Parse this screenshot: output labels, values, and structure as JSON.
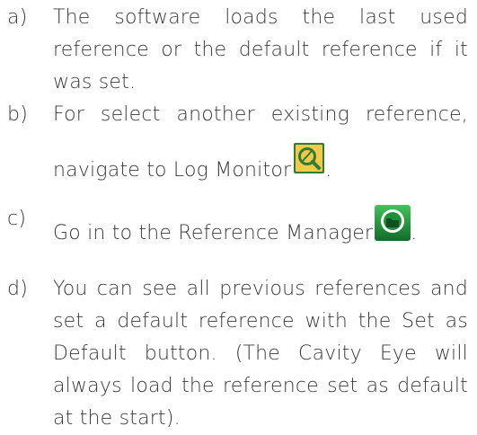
{
  "steps": [
    {
      "marker": "a)",
      "lines": [
        "The software loads the last used",
        "reference or the default reference if it",
        "was set."
      ]
    },
    {
      "marker": "b)",
      "lines": [
        "For select another existing reference,",
        "navigate to Log Monitor"
      ],
      "trailing": ".",
      "icon": "log-monitor-icon"
    },
    {
      "marker": "c)",
      "lines": [
        "Go in to the Reference Manager"
      ],
      "trailing": ".",
      "icon": "reference-manager-icon"
    },
    {
      "marker": "d)",
      "lines": [
        "You can see all previous references and",
        "set a default reference with the Set as",
        "Default button. (The Cavity Eye will",
        "always load the reference set as default",
        "at the start)."
      ]
    }
  ],
  "colors": {
    "text": "#3a3a3a",
    "log_icon_green": "#2e7d32",
    "log_icon_yellow": "#f2c94c",
    "ref_icon_green": "#1f8f3a"
  }
}
